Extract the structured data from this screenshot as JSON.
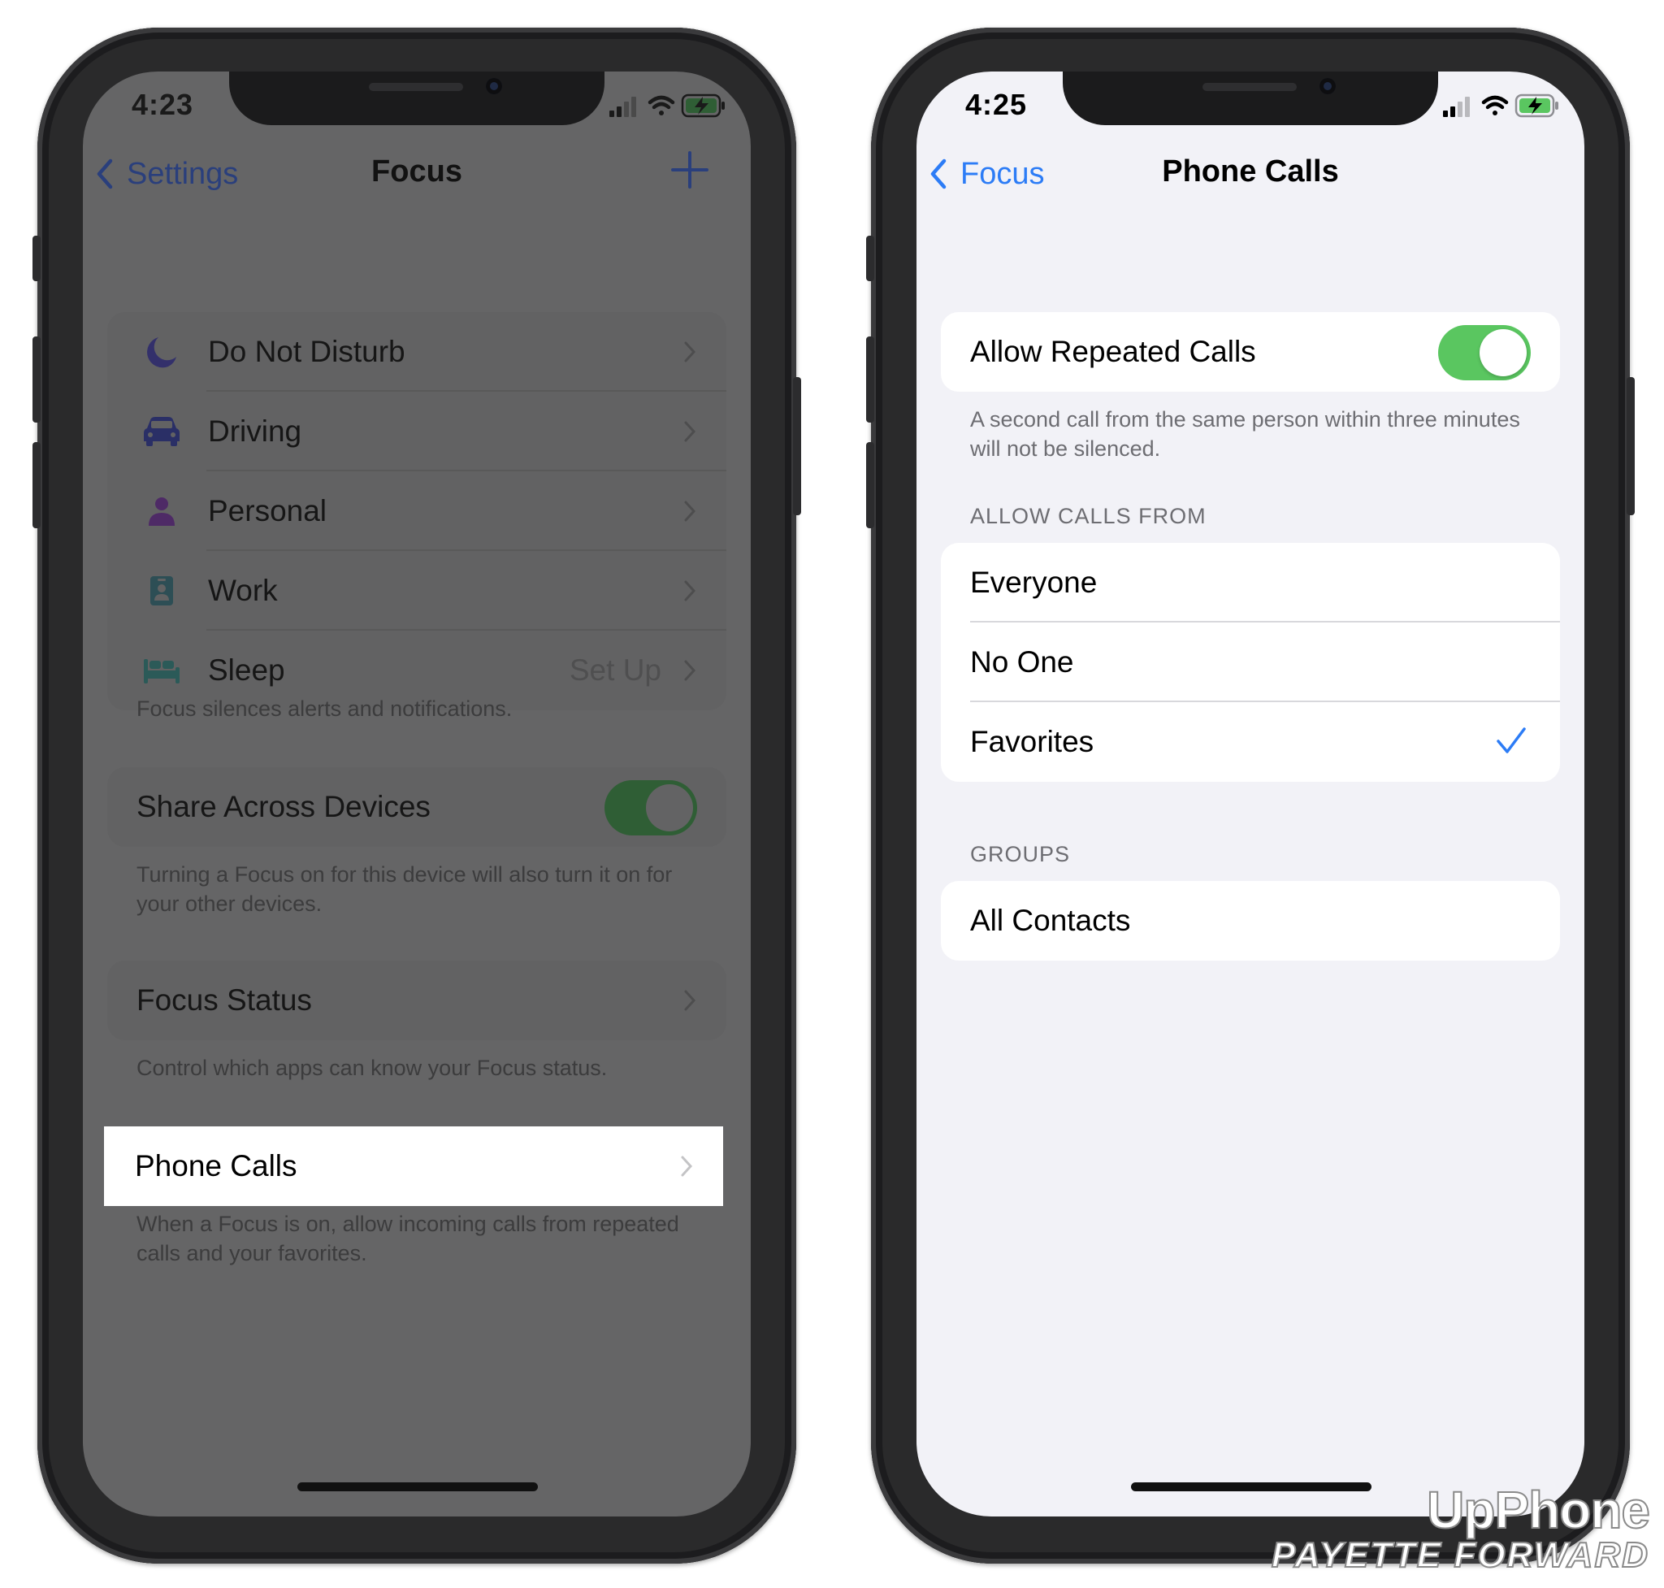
{
  "left_phone": {
    "time": "4:23",
    "nav": {
      "back_label": "Settings",
      "title": "Focus"
    },
    "focus_modes": [
      {
        "label": "Do Not Disturb",
        "icon": "moon-icon",
        "detail": ""
      },
      {
        "label": "Driving",
        "icon": "car-icon",
        "detail": ""
      },
      {
        "label": "Personal",
        "icon": "person-icon",
        "detail": ""
      },
      {
        "label": "Work",
        "icon": "badge-icon",
        "detail": ""
      },
      {
        "label": "Sleep",
        "icon": "bed-icon",
        "detail": "Set Up"
      }
    ],
    "focus_footer": "Focus silences alerts and notifications.",
    "share_across_devices": {
      "label": "Share Across Devices",
      "enabled": true
    },
    "share_footer": "Turning a Focus on for this device will also turn it on for your other devices.",
    "focus_status": {
      "label": "Focus Status"
    },
    "focus_status_footer": "Control which apps can know your Focus status.",
    "phone_calls": {
      "label": "Phone Calls"
    },
    "phone_calls_footer": "When a Focus is on, allow incoming calls from repeated calls and your favorites."
  },
  "right_phone": {
    "time": "4:25",
    "nav": {
      "back_label": "Focus",
      "title": "Phone Calls"
    },
    "allow_repeated_calls": {
      "label": "Allow Repeated Calls",
      "enabled": true
    },
    "repeated_footer": "A second call from the same person within three minutes will not be silenced.",
    "allow_calls_from_header": "ALLOW CALLS FROM",
    "allow_calls_from_options": [
      {
        "label": "Everyone",
        "selected": false
      },
      {
        "label": "No One",
        "selected": false
      },
      {
        "label": "Favorites",
        "selected": true
      }
    ],
    "groups_header": "GROUPS",
    "groups": [
      {
        "label": "All Contacts"
      }
    ]
  },
  "watermark": {
    "line1": "UpPhone",
    "line2": "PAYETTE FORWARD"
  },
  "colors": {
    "ios_blue": "#2c7cf6",
    "toggle_green": "#5ac660",
    "dimmed_background": "#656566",
    "grouped_background": "#f2f2f7"
  }
}
